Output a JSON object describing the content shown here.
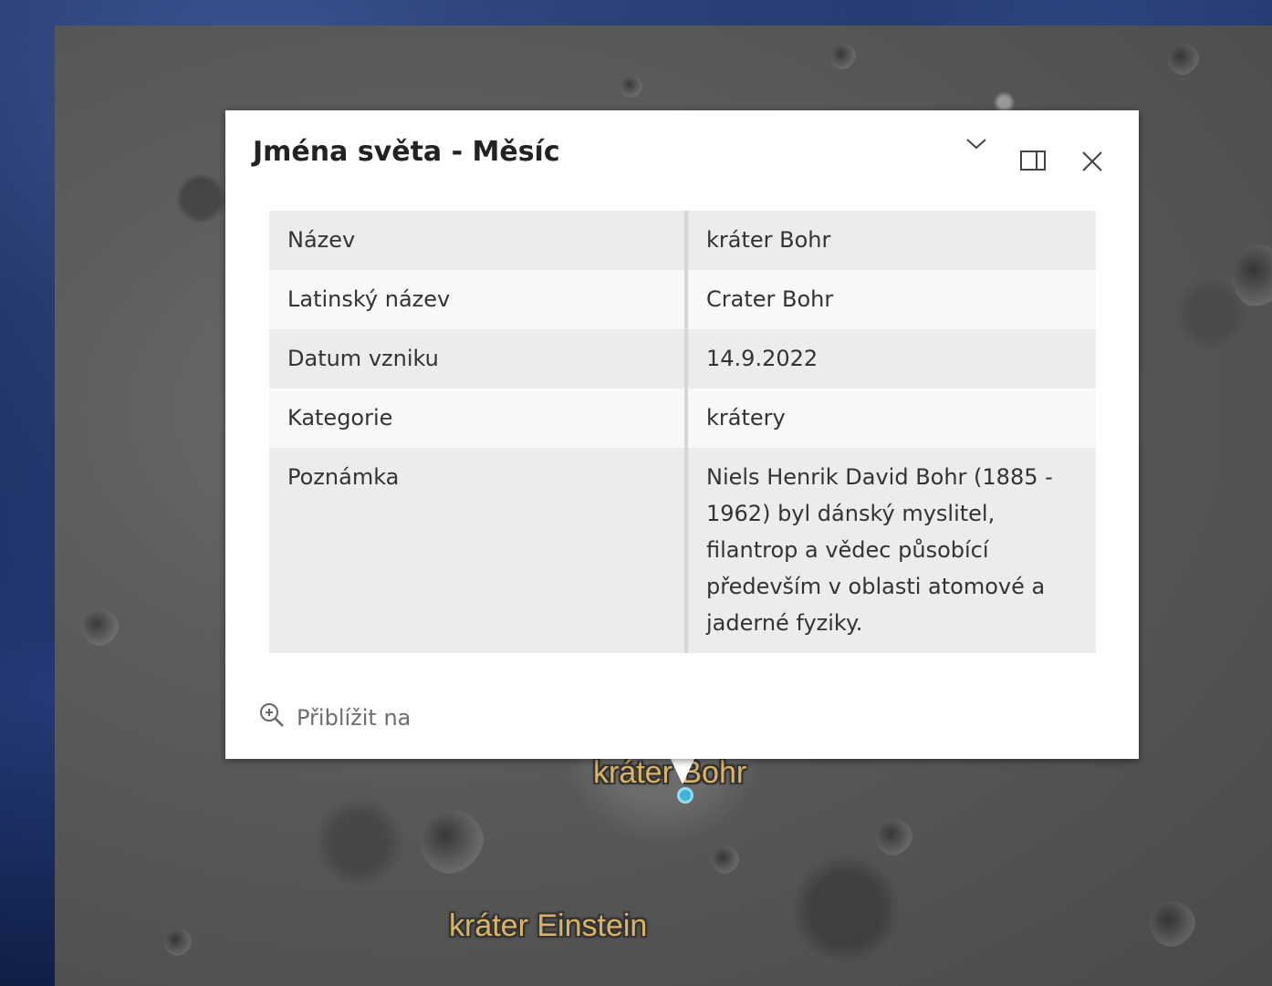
{
  "popup": {
    "title": "Jména světa - Měsíc",
    "collapse_icon": "chevron-down-icon",
    "dock_icon": "dock-icon",
    "close_icon": "close-icon",
    "attributes": [
      {
        "key": "Název",
        "value": "kráter Bohr"
      },
      {
        "key": "Latinský název",
        "value": "Crater Bohr"
      },
      {
        "key": "Datum vzniku",
        "value": "14.9.2022"
      },
      {
        "key": "Kategorie",
        "value": "krátery"
      },
      {
        "key": "Poznámka",
        "value": "Niels Henrik David Bohr (1885 - 1962) byl dánský myslitel, filantrop a vědec působící především v oblasti atomové a jaderné fyziky."
      }
    ],
    "zoom_to_label": "Přiblížit na",
    "zoom_icon": "zoom-in-icon"
  },
  "map": {
    "labels": {
      "bohr": "kráter Bohr",
      "einstein": "kráter Einstein"
    },
    "marker_color": "#3fb3d8"
  }
}
